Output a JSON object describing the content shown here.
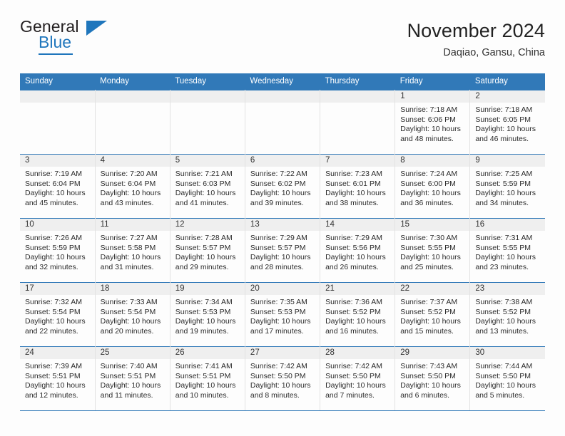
{
  "brand": {
    "name_part1": "General",
    "name_part2": "Blue",
    "triangle_icon": "triangle-icon",
    "accent_color": "#1f76bc"
  },
  "header": {
    "title": "November 2024",
    "subtitle": "Daqiao, Gansu, China"
  },
  "theme": {
    "header_blue": "#3179b8",
    "daynum_band": "#efefef",
    "page_background": "#fdfdfd"
  },
  "weekday_headers": [
    "Sunday",
    "Monday",
    "Tuesday",
    "Wednesday",
    "Thursday",
    "Friday",
    "Saturday"
  ],
  "labels": {
    "sunrise_prefix": "Sunrise:",
    "sunset_prefix": "Sunset:",
    "daylight_prefix": "Daylight:"
  },
  "weeks": [
    [
      {
        "day": "",
        "line1": "",
        "line2": "",
        "line3": "",
        "line4": ""
      },
      {
        "day": "",
        "line1": "",
        "line2": "",
        "line3": "",
        "line4": ""
      },
      {
        "day": "",
        "line1": "",
        "line2": "",
        "line3": "",
        "line4": ""
      },
      {
        "day": "",
        "line1": "",
        "line2": "",
        "line3": "",
        "line4": ""
      },
      {
        "day": "",
        "line1": "",
        "line2": "",
        "line3": "",
        "line4": ""
      },
      {
        "day": "1",
        "line1": "Sunrise: 7:18 AM",
        "line2": "Sunset: 6:06 PM",
        "line3": "Daylight: 10 hours",
        "line4": "and 48 minutes."
      },
      {
        "day": "2",
        "line1": "Sunrise: 7:18 AM",
        "line2": "Sunset: 6:05 PM",
        "line3": "Daylight: 10 hours",
        "line4": "and 46 minutes."
      }
    ],
    [
      {
        "day": "3",
        "line1": "Sunrise: 7:19 AM",
        "line2": "Sunset: 6:04 PM",
        "line3": "Daylight: 10 hours",
        "line4": "and 45 minutes."
      },
      {
        "day": "4",
        "line1": "Sunrise: 7:20 AM",
        "line2": "Sunset: 6:04 PM",
        "line3": "Daylight: 10 hours",
        "line4": "and 43 minutes."
      },
      {
        "day": "5",
        "line1": "Sunrise: 7:21 AM",
        "line2": "Sunset: 6:03 PM",
        "line3": "Daylight: 10 hours",
        "line4": "and 41 minutes."
      },
      {
        "day": "6",
        "line1": "Sunrise: 7:22 AM",
        "line2": "Sunset: 6:02 PM",
        "line3": "Daylight: 10 hours",
        "line4": "and 39 minutes."
      },
      {
        "day": "7",
        "line1": "Sunrise: 7:23 AM",
        "line2": "Sunset: 6:01 PM",
        "line3": "Daylight: 10 hours",
        "line4": "and 38 minutes."
      },
      {
        "day": "8",
        "line1": "Sunrise: 7:24 AM",
        "line2": "Sunset: 6:00 PM",
        "line3": "Daylight: 10 hours",
        "line4": "and 36 minutes."
      },
      {
        "day": "9",
        "line1": "Sunrise: 7:25 AM",
        "line2": "Sunset: 5:59 PM",
        "line3": "Daylight: 10 hours",
        "line4": "and 34 minutes."
      }
    ],
    [
      {
        "day": "10",
        "line1": "Sunrise: 7:26 AM",
        "line2": "Sunset: 5:59 PM",
        "line3": "Daylight: 10 hours",
        "line4": "and 32 minutes."
      },
      {
        "day": "11",
        "line1": "Sunrise: 7:27 AM",
        "line2": "Sunset: 5:58 PM",
        "line3": "Daylight: 10 hours",
        "line4": "and 31 minutes."
      },
      {
        "day": "12",
        "line1": "Sunrise: 7:28 AM",
        "line2": "Sunset: 5:57 PM",
        "line3": "Daylight: 10 hours",
        "line4": "and 29 minutes."
      },
      {
        "day": "13",
        "line1": "Sunrise: 7:29 AM",
        "line2": "Sunset: 5:57 PM",
        "line3": "Daylight: 10 hours",
        "line4": "and 28 minutes."
      },
      {
        "day": "14",
        "line1": "Sunrise: 7:29 AM",
        "line2": "Sunset: 5:56 PM",
        "line3": "Daylight: 10 hours",
        "line4": "and 26 minutes."
      },
      {
        "day": "15",
        "line1": "Sunrise: 7:30 AM",
        "line2": "Sunset: 5:55 PM",
        "line3": "Daylight: 10 hours",
        "line4": "and 25 minutes."
      },
      {
        "day": "16",
        "line1": "Sunrise: 7:31 AM",
        "line2": "Sunset: 5:55 PM",
        "line3": "Daylight: 10 hours",
        "line4": "and 23 minutes."
      }
    ],
    [
      {
        "day": "17",
        "line1": "Sunrise: 7:32 AM",
        "line2": "Sunset: 5:54 PM",
        "line3": "Daylight: 10 hours",
        "line4": "and 22 minutes."
      },
      {
        "day": "18",
        "line1": "Sunrise: 7:33 AM",
        "line2": "Sunset: 5:54 PM",
        "line3": "Daylight: 10 hours",
        "line4": "and 20 minutes."
      },
      {
        "day": "19",
        "line1": "Sunrise: 7:34 AM",
        "line2": "Sunset: 5:53 PM",
        "line3": "Daylight: 10 hours",
        "line4": "and 19 minutes."
      },
      {
        "day": "20",
        "line1": "Sunrise: 7:35 AM",
        "line2": "Sunset: 5:53 PM",
        "line3": "Daylight: 10 hours",
        "line4": "and 17 minutes."
      },
      {
        "day": "21",
        "line1": "Sunrise: 7:36 AM",
        "line2": "Sunset: 5:52 PM",
        "line3": "Daylight: 10 hours",
        "line4": "and 16 minutes."
      },
      {
        "day": "22",
        "line1": "Sunrise: 7:37 AM",
        "line2": "Sunset: 5:52 PM",
        "line3": "Daylight: 10 hours",
        "line4": "and 15 minutes."
      },
      {
        "day": "23",
        "line1": "Sunrise: 7:38 AM",
        "line2": "Sunset: 5:52 PM",
        "line3": "Daylight: 10 hours",
        "line4": "and 13 minutes."
      }
    ],
    [
      {
        "day": "24",
        "line1": "Sunrise: 7:39 AM",
        "line2": "Sunset: 5:51 PM",
        "line3": "Daylight: 10 hours",
        "line4": "and 12 minutes."
      },
      {
        "day": "25",
        "line1": "Sunrise: 7:40 AM",
        "line2": "Sunset: 5:51 PM",
        "line3": "Daylight: 10 hours",
        "line4": "and 11 minutes."
      },
      {
        "day": "26",
        "line1": "Sunrise: 7:41 AM",
        "line2": "Sunset: 5:51 PM",
        "line3": "Daylight: 10 hours",
        "line4": "and 10 minutes."
      },
      {
        "day": "27",
        "line1": "Sunrise: 7:42 AM",
        "line2": "Sunset: 5:50 PM",
        "line3": "Daylight: 10 hours",
        "line4": "and 8 minutes."
      },
      {
        "day": "28",
        "line1": "Sunrise: 7:42 AM",
        "line2": "Sunset: 5:50 PM",
        "line3": "Daylight: 10 hours",
        "line4": "and 7 minutes."
      },
      {
        "day": "29",
        "line1": "Sunrise: 7:43 AM",
        "line2": "Sunset: 5:50 PM",
        "line3": "Daylight: 10 hours",
        "line4": "and 6 minutes."
      },
      {
        "day": "30",
        "line1": "Sunrise: 7:44 AM",
        "line2": "Sunset: 5:50 PM",
        "line3": "Daylight: 10 hours",
        "line4": "and 5 minutes."
      }
    ]
  ]
}
